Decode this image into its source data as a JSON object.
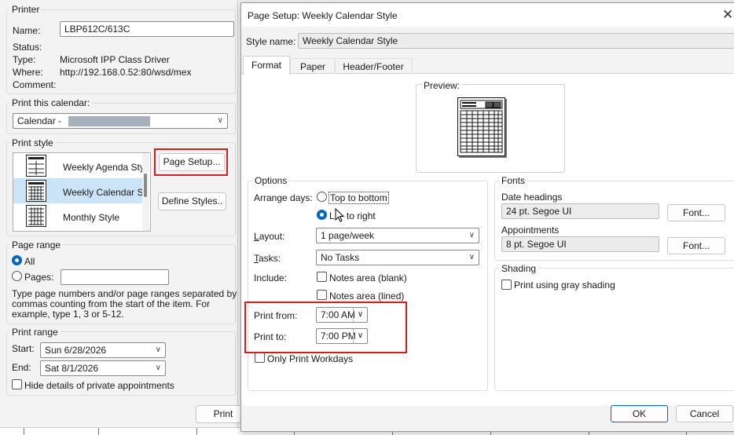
{
  "print_dialog": {
    "printer_group": "Printer",
    "name_label": "Name:",
    "name_value": "LBP612C/613C",
    "status_label": "Status:",
    "type_label": "Type:",
    "type_value": "Microsoft IPP Class Driver",
    "where_label": "Where:",
    "where_value": "http://192.168.0.52:80/wsd/mex",
    "comment_label": "Comment:",
    "calendar_group": "Print this calendar:",
    "calendar_value": "Calendar -",
    "style_group": "Print style",
    "styles": [
      "Weekly Agenda Sty",
      "Weekly Calendar S",
      "Monthly Style"
    ],
    "page_setup_btn": "Page Setup...",
    "define_styles_btn": "Define Styles..",
    "page_range_group": "Page range",
    "all_label": "All",
    "pages_label": "Pages:",
    "range_help": [
      "Type page numbers and/or page ranges separated by",
      "commas counting from the start of the item.  For",
      "example, type 1, 3 or 5-12."
    ],
    "print_range_group": "Print range",
    "start_label": "Start:",
    "start_value": "Sun 6/28/2026",
    "end_label": "End:",
    "end_value": "Sat 8/1/2026",
    "hide_private": "Hide details of private appointments",
    "print_btn": "Print"
  },
  "page_setup": {
    "title": "Page Setup: Weekly Calendar Style",
    "style_name_label": "Style name:",
    "style_name_value": "Weekly Calendar Style",
    "tabs": [
      "Format",
      "Paper",
      "Header/Footer"
    ],
    "preview_label": "Preview:",
    "options_group": "Options",
    "arrange_days_label": "Arrange days:",
    "top_to_bottom": "Top to bottom",
    "left_to_right_a": "L",
    "left_to_right_b": " to right",
    "layout_label": "Layout:",
    "layout_value": "1 page/week",
    "tasks_label": "Tasks:",
    "tasks_value": "No Tasks",
    "include_label": "Include:",
    "notes_blank": "Notes area (blank)",
    "notes_lined": "Notes area (lined)",
    "print_from_label": "Print from:",
    "print_from_value": "7:00 AM",
    "print_to_label": "Print to:",
    "print_to_value": "7:00 PM",
    "only_workdays": "Only Print Workdays",
    "fonts_group": "Fonts",
    "date_headings_label": "Date headings",
    "date_headings_value": "24 pt. Segoe UI",
    "appointments_label": "Appointments",
    "appointments_value": "8 pt. Segoe UI",
    "font_btn": "Font...",
    "shading_group": "Shading",
    "gray_shading": "Print using gray shading",
    "ok_btn": "OK",
    "cancel_btn": "Cancel"
  },
  "colors": {
    "highlight_box": "#d41c1c",
    "accent": "#0067c0",
    "selected_row": "#cce4f7"
  }
}
